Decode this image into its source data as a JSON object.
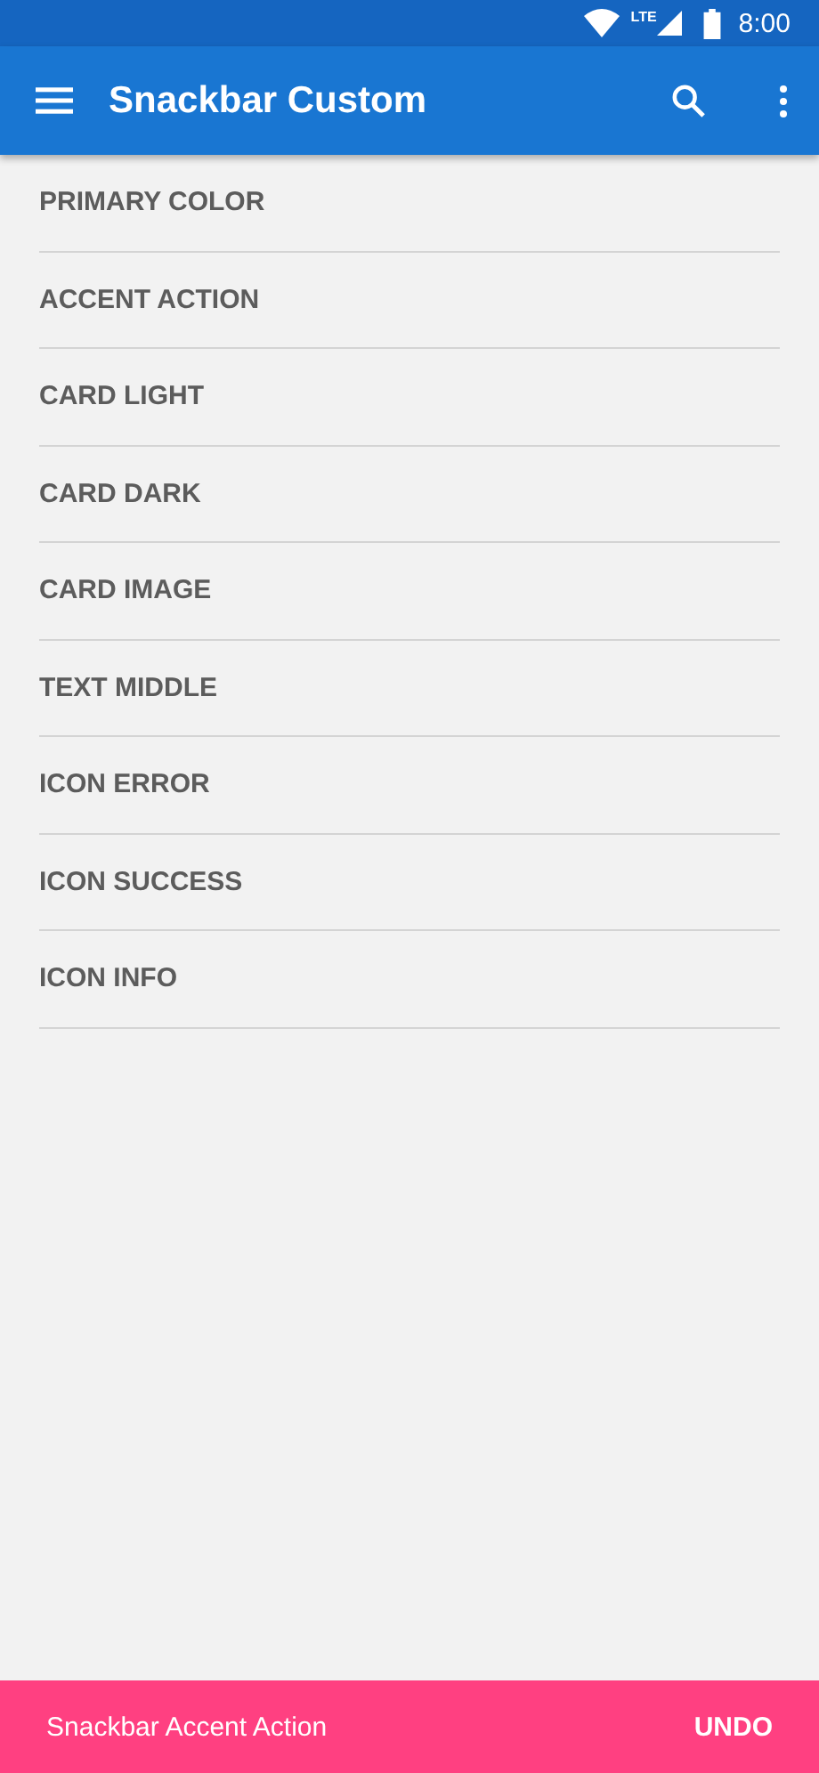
{
  "status_bar": {
    "network": "LTE",
    "time": "8:00"
  },
  "app_bar": {
    "title": "Snackbar Custom"
  },
  "list": {
    "items": [
      {
        "label": "PRIMARY COLOR"
      },
      {
        "label": "ACCENT ACTION"
      },
      {
        "label": "CARD LIGHT"
      },
      {
        "label": "CARD DARK"
      },
      {
        "label": "CARD IMAGE"
      },
      {
        "label": "TEXT MIDDLE"
      },
      {
        "label": "ICON ERROR"
      },
      {
        "label": "ICON SUCCESS"
      },
      {
        "label": "ICON INFO"
      }
    ]
  },
  "snackbar": {
    "message": "Snackbar Accent Action",
    "action": "UNDO"
  }
}
